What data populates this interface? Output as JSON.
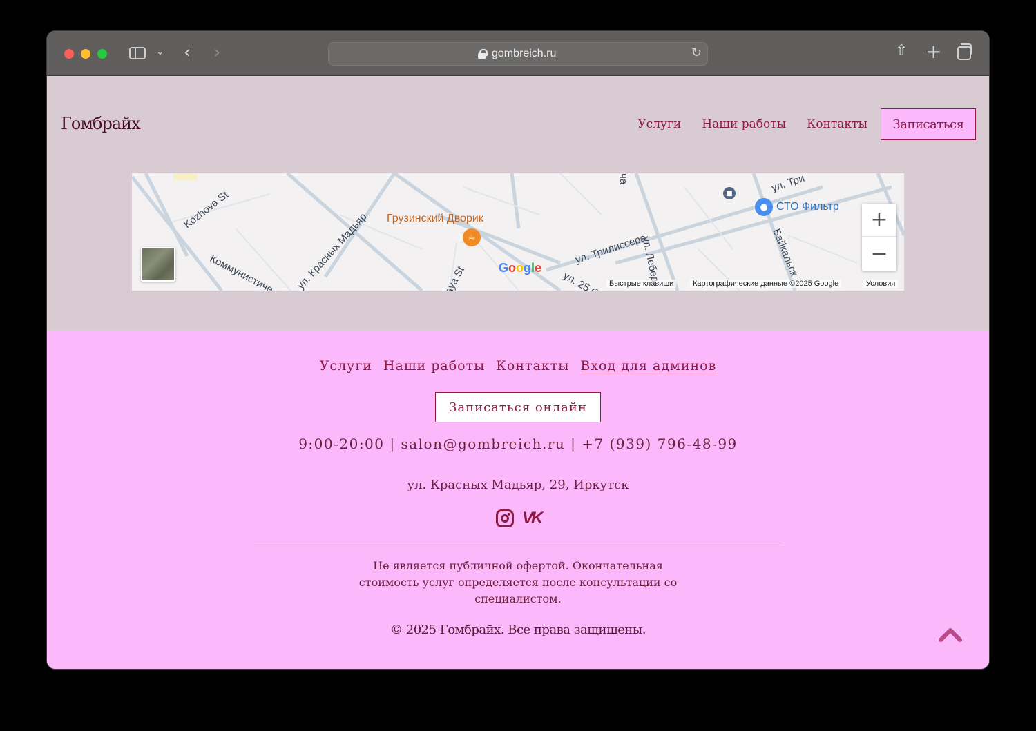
{
  "browser": {
    "url": "gombreich.ru"
  },
  "header": {
    "logo": "Гомбрайх",
    "nav": [
      "Услуги",
      "Наши работы",
      "Контакты"
    ],
    "cta": "Записаться"
  },
  "map": {
    "streets": [
      "Kozhova St",
      "ул. Красных Мадьяр",
      "Коммунистиче",
      "aya St",
      "ул. Трилиссера",
      "ул. Лебед",
      "Байкальск",
      "ул. Три",
      "ул. 25 О",
      "ча"
    ],
    "pois": {
      "cafe": "Грузинский Дворик",
      "service": "СТО Фильтр"
    },
    "google_logo": "Google",
    "shortcuts": "Быстрые клавиши",
    "copyright": "Картографические данные ©2025 Google",
    "terms": "Условия",
    "zoom_in": "+",
    "zoom_out": "−"
  },
  "footer": {
    "nav": [
      "Услуги",
      "Наши работы",
      "Контакты",
      "Вход для админов"
    ],
    "cta": "Записаться онлайн",
    "contacts": "9:00-20:00 | salon@gombreich.ru | +7 (939) 796-48-99",
    "address": "ул. Красных Мадьяр, 29, Иркутск",
    "socials": [
      "instagram-icon",
      "vk-icon"
    ],
    "disclaimer": "Не является публичной офертой. Окончательная стоимость услуг определяется после консультации со специалистом.",
    "copyright": "© 2025 Гомбрайх. Все права защищены."
  },
  "colors": {
    "accent": "#8e1a44",
    "header_bg": "#d8cbd1",
    "footer_bg": "#fbb8fb"
  }
}
